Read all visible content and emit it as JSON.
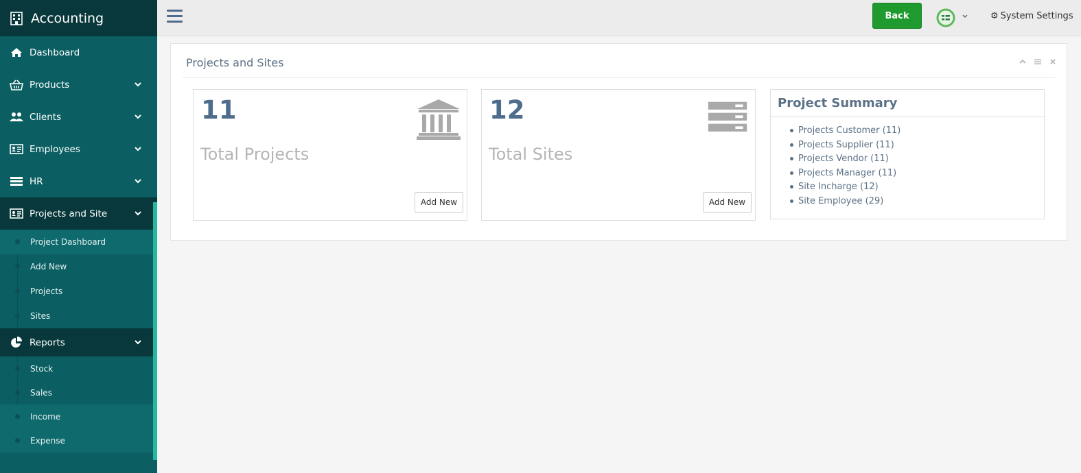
{
  "sidebar": {
    "brand": "Accounting",
    "items": [
      {
        "label": "Dashboard",
        "icon": "home-icon"
      },
      {
        "label": "Products",
        "icon": "basket-icon"
      },
      {
        "label": "Clients",
        "icon": "users-icon"
      },
      {
        "label": "Employees",
        "icon": "id-card-icon"
      },
      {
        "label": "HR",
        "icon": "server-icon"
      },
      {
        "label": "Projects and Site",
        "icon": "id-card-icon"
      },
      {
        "label": "Reports",
        "icon": "pie-chart-icon"
      }
    ],
    "projects_sub": [
      "Project Dashboard",
      "Add New",
      "Projects",
      "Sites"
    ],
    "reports_sub": [
      "Stock",
      "Sales",
      "Income",
      "Expense"
    ]
  },
  "topbar": {
    "back_label": "Back",
    "settings_label": "System Settings"
  },
  "panel": {
    "title": "Projects and Sites",
    "total_projects": {
      "value": "11",
      "label": "Total Projects",
      "button": "Add New"
    },
    "total_sites": {
      "value": "12",
      "label": "Total Sites",
      "button": "Add New"
    },
    "summary": {
      "title": "Project Summary",
      "items": [
        "Projects Customer (11)",
        "Projects Supplier (11)",
        "Projects Vendor (11)",
        "Projects Manager (11)",
        "Site Incharge (12)",
        "Site Employee (29)"
      ]
    }
  },
  "colors": {
    "sidebar": "#0b5f63",
    "sidebar_dark": "#08383c",
    "accent": "#25b7a0",
    "back_button": "#1f9a2e",
    "heading": "#4e6d8c"
  }
}
